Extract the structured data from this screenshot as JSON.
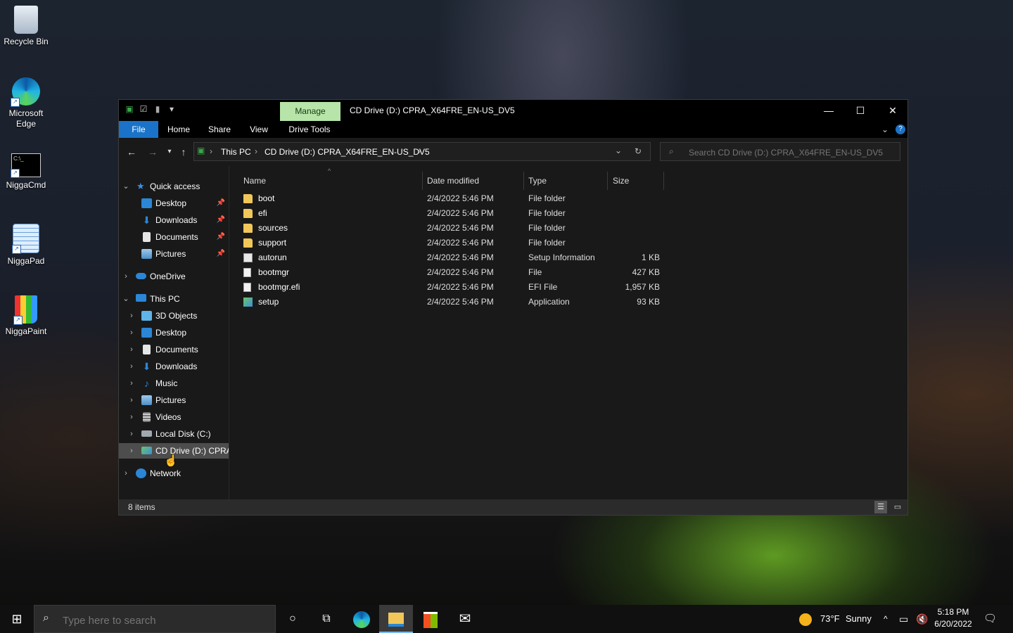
{
  "desktop": {
    "icons": [
      {
        "label": "Recycle Bin"
      },
      {
        "label": "Microsoft Edge"
      },
      {
        "label": "NiggaCmd"
      },
      {
        "label": "NiggaPad"
      },
      {
        "label": "NiggaPaint"
      }
    ]
  },
  "window": {
    "title": "CD Drive (D:) CPRA_X64FRE_EN-US_DV5",
    "manage_tab": "Manage",
    "ribbon_tabs": [
      "File",
      "Home",
      "Share",
      "View",
      "Drive Tools"
    ],
    "breadcrumb": [
      "This PC",
      "CD Drive (D:) CPRA_X64FRE_EN-US_DV5"
    ],
    "search_placeholder": "Search CD Drive (D:) CPRA_X64FRE_EN-US_DV5"
  },
  "navpane": {
    "quick_access": "Quick access",
    "quick_items": [
      "Desktop",
      "Downloads",
      "Documents",
      "Pictures"
    ],
    "onedrive": "OneDrive",
    "this_pc": "This PC",
    "pc_items": [
      "3D Objects",
      "Desktop",
      "Documents",
      "Downloads",
      "Music",
      "Pictures",
      "Videos",
      "Local Disk (C:)",
      "CD Drive (D:) CPRA"
    ],
    "network": "Network"
  },
  "columns": [
    "Name",
    "Date modified",
    "Type",
    "Size"
  ],
  "files": [
    {
      "name": "boot",
      "date": "2/4/2022 5:46 PM",
      "type": "File folder",
      "size": "",
      "icon": "folder-icon"
    },
    {
      "name": "efi",
      "date": "2/4/2022 5:46 PM",
      "type": "File folder",
      "size": "",
      "icon": "folder-icon"
    },
    {
      "name": "sources",
      "date": "2/4/2022 5:46 PM",
      "type": "File folder",
      "size": "",
      "icon": "folder-icon"
    },
    {
      "name": "support",
      "date": "2/4/2022 5:46 PM",
      "type": "File folder",
      "size": "",
      "icon": "folder-icon"
    },
    {
      "name": "autorun",
      "date": "2/4/2022 5:46 PM",
      "type": "Setup Information",
      "size": "1 KB",
      "icon": "setup-info-icon"
    },
    {
      "name": "bootmgr",
      "date": "2/4/2022 5:46 PM",
      "type": "File",
      "size": "427 KB",
      "icon": "file-icon"
    },
    {
      "name": "bootmgr.efi",
      "date": "2/4/2022 5:46 PM",
      "type": "EFI File",
      "size": "1,957 KB",
      "icon": "file-icon"
    },
    {
      "name": "setup",
      "date": "2/4/2022 5:46 PM",
      "type": "Application",
      "size": "93 KB",
      "icon": "app-icon"
    }
  ],
  "status": {
    "items": "8 items"
  },
  "taskbar": {
    "search_placeholder": "Type here to search",
    "weather_temp": "73°F",
    "weather_text": "Sunny",
    "time": "5:18 PM",
    "date": "6/20/2022"
  },
  "colors": {
    "accent": "#1a73c8",
    "manage": "#b7e4a8",
    "folder": "#f1c75a"
  }
}
